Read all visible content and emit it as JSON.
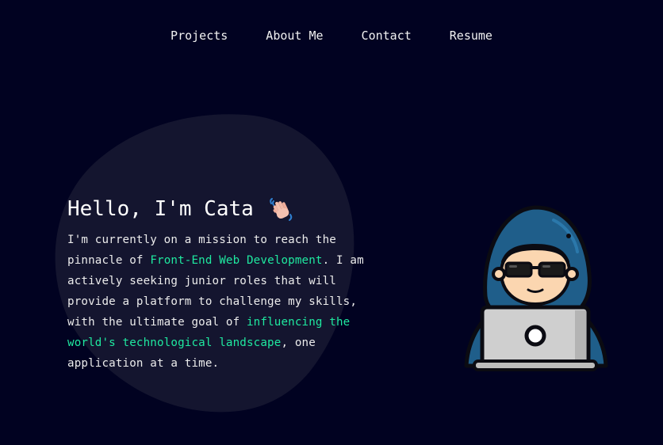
{
  "nav": {
    "items": [
      {
        "label": "Projects"
      },
      {
        "label": "About Me"
      },
      {
        "label": "Contact"
      },
      {
        "label": "Resume"
      }
    ]
  },
  "hero": {
    "heading": "Hello, I'm Cata",
    "wave_icon": "waving-hand-icon",
    "bio_lines": [
      [
        "I'm currently on a mission to reach the"
      ],
      [
        "pinnacle of ",
        {
          "accent": "Front-End Web Development"
        },
        ". I am"
      ],
      [
        "actively seeking junior roles that will"
      ],
      [
        "provide a platform to challenge my skills,"
      ],
      [
        "with the ultimate goal of ",
        {
          "accent": "influencing the"
        }
      ],
      [
        {
          "accent": "world's technological landscape"
        },
        ", one"
      ],
      [
        "application at a time."
      ]
    ]
  },
  "avatar": {
    "icon": "hooded-hacker-with-laptop-icon"
  },
  "colors": {
    "background": "#010221",
    "blob": "#14152f",
    "accent": "#1fe9a0",
    "hood": "#1f5e8a"
  }
}
